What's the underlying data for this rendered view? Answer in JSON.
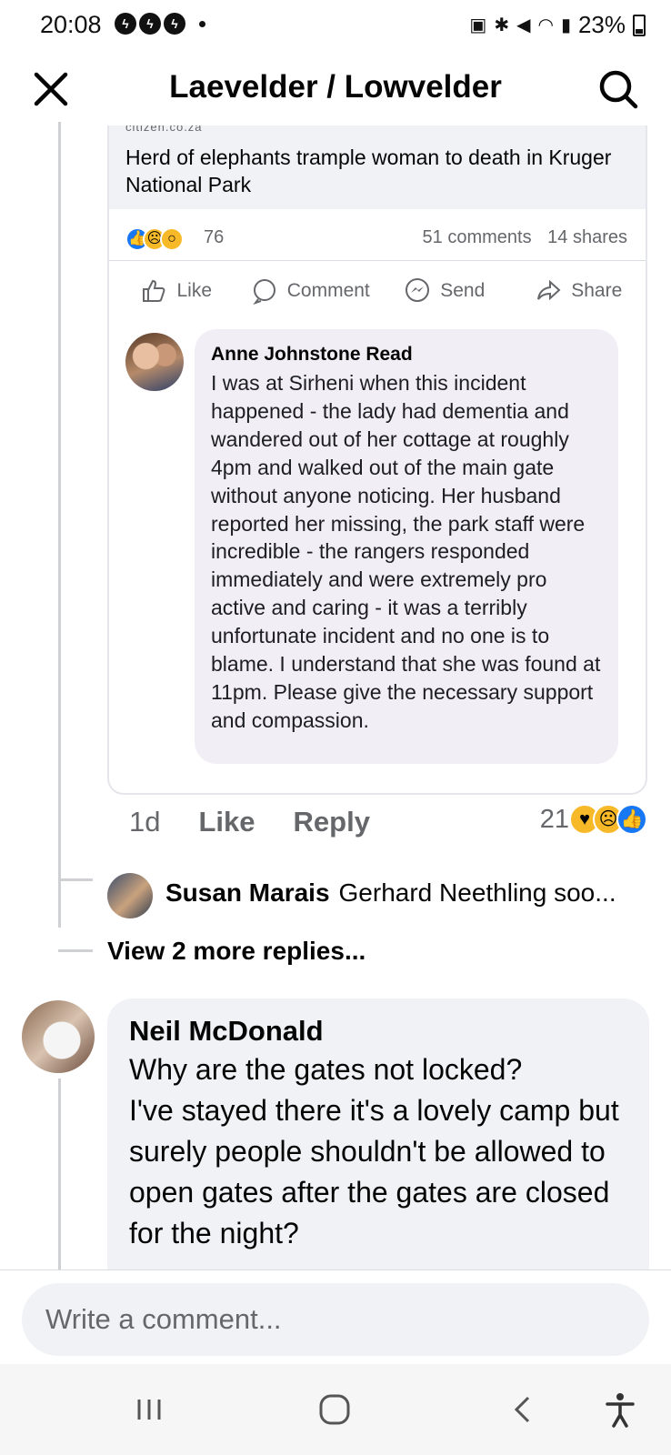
{
  "status_bar": {
    "time": "20:08",
    "notif_icons": [
      "messenger-icon",
      "messenger-icon",
      "messenger-icon"
    ],
    "battery": "23%"
  },
  "header": {
    "title": "Laevelder / Lowvelder"
  },
  "shared_post": {
    "link_domain": "citizen.co.za",
    "link_title": "Herd of elephants trample woman to death in Kruger National Park",
    "reactions_count": "76",
    "comments": "51 comments",
    "shares": "14 shares",
    "actions": {
      "like": "Like",
      "comment": "Comment",
      "send": "Send",
      "share": "Share"
    },
    "inner_comment": {
      "author": "Anne Johnstone Read",
      "text": "I was at Sirheni when this incident happened - the lady had dementia and wandered out of her cottage at roughly 4pm and walked out of the main gate without anyone noticing. Her husband reported her missing, the park staff were incredible - the rangers responded immediately and were extremely pro active and caring - it was a terribly unfortunate incident and no one is to blame. I understand that she was found at 11pm. Please give the necessary support and compassion."
    }
  },
  "comment_meta": {
    "time": "1d",
    "like": "Like",
    "reply": "Reply",
    "reaction_count": "21"
  },
  "reply": {
    "author": "Susan Marais",
    "preview": "Gerhard Neethling soo...",
    "view_more": "View 2 more replies..."
  },
  "main_comment": {
    "author": "Neil McDonald",
    "text": "Why are the gates not locked?\nI've stayed there it's a lovely camp but surely people shouldn't be allowed to open gates after the gates are closed for the night?"
  },
  "composer": {
    "placeholder": "Write a comment..."
  },
  "colors": {
    "accent_blue": "#1877f2",
    "bubble_gray": "#f0f2f5",
    "secondary_text": "#65676b"
  }
}
